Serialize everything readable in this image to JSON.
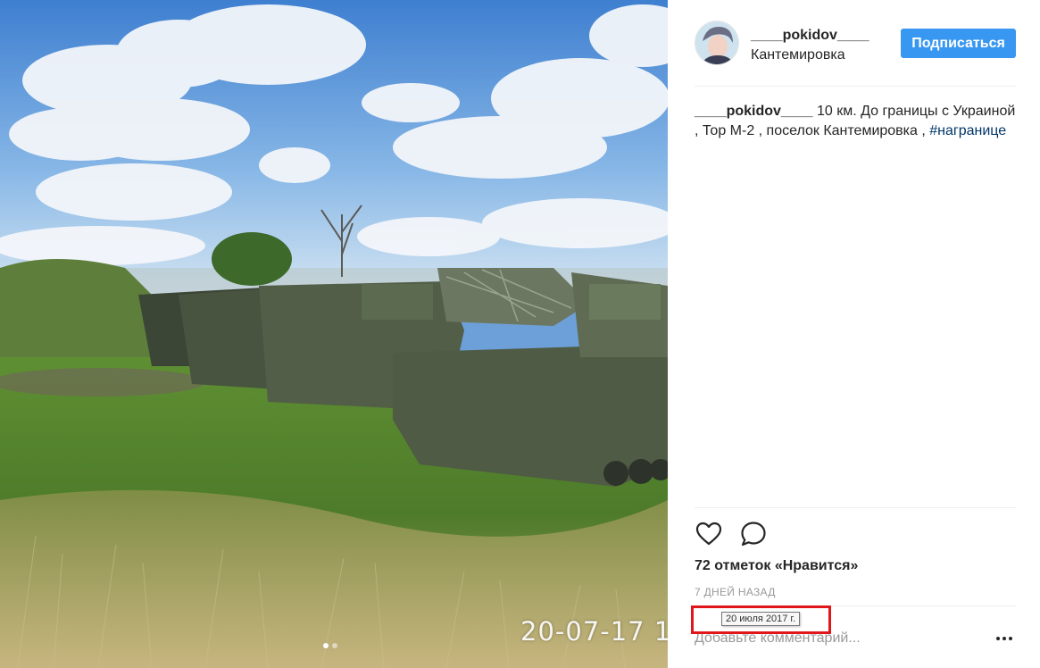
{
  "post": {
    "username": "____pokidov____",
    "location": "Кантемировка",
    "follow_label": "Подписаться",
    "caption": {
      "username": "____pokidov____",
      "text": " 10 км. До границы с Украиной , Тор М-2 , поселок Кантемировка , ",
      "hashtag": "#награнице"
    },
    "likes_text": "72 отметок «Нравится»",
    "time_ago": "7 ДНЕЙ НАЗАД",
    "date_tooltip": "20 июля 2017 г.",
    "comment_placeholder": "Добавьте комментарий..."
  },
  "photo": {
    "timestamp_overlay": "20-07-17 1",
    "carousel": {
      "count": 2,
      "active_index": 0
    }
  },
  "icons": {
    "like": "heart-icon",
    "comment": "speech-bubble-icon",
    "more": "ellipsis-icon"
  },
  "colors": {
    "follow_button": "#3897f0",
    "hashtag": "#003569",
    "highlight": "#e0161b",
    "muted_text": "#999999"
  }
}
